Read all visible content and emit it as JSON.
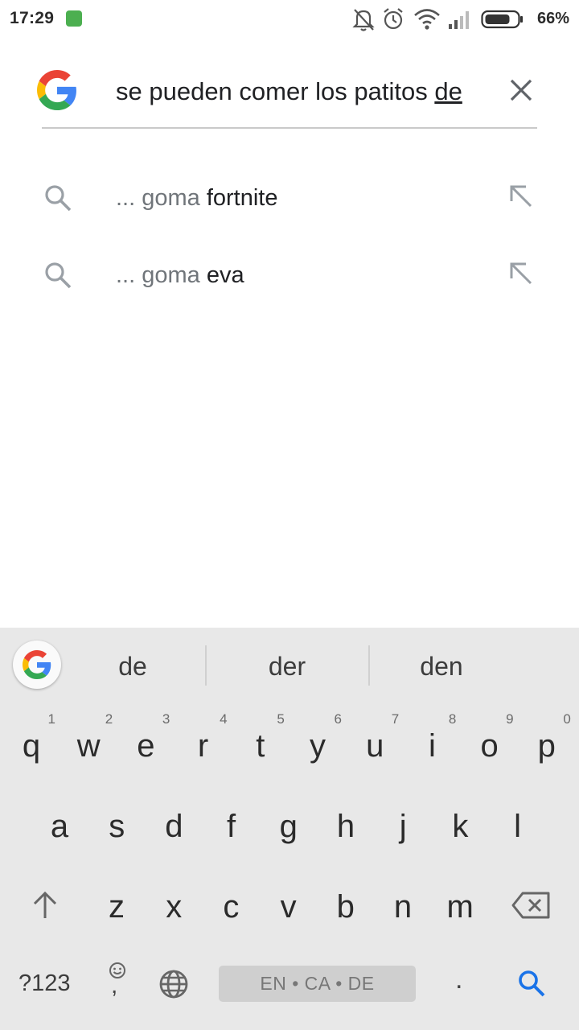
{
  "status_bar": {
    "time": "17:29",
    "battery_percent": "66%",
    "icons": [
      "android-app-icon",
      "bell-muted-icon",
      "alarm-icon",
      "wifi-icon",
      "signal-icon",
      "battery-icon"
    ]
  },
  "search": {
    "query_main": "se pueden comer los patitos ",
    "query_underlined": "de",
    "clear_icon": "close-icon"
  },
  "suggestions": [
    {
      "prefix": "... goma ",
      "completion": "fortnite"
    },
    {
      "prefix": "... goma ",
      "completion": "eva"
    }
  ],
  "keyboard": {
    "word_suggestions": [
      "de",
      "der",
      "den"
    ],
    "row1": [
      {
        "key": "q",
        "hint": "1"
      },
      {
        "key": "w",
        "hint": "2"
      },
      {
        "key": "e",
        "hint": "3"
      },
      {
        "key": "r",
        "hint": "4"
      },
      {
        "key": "t",
        "hint": "5"
      },
      {
        "key": "y",
        "hint": "6"
      },
      {
        "key": "u",
        "hint": "7"
      },
      {
        "key": "i",
        "hint": "8"
      },
      {
        "key": "o",
        "hint": "9"
      },
      {
        "key": "p",
        "hint": "0"
      }
    ],
    "row2": [
      "a",
      "s",
      "d",
      "f",
      "g",
      "h",
      "j",
      "k",
      "l"
    ],
    "row3": [
      "z",
      "x",
      "c",
      "v",
      "b",
      "n",
      "m"
    ],
    "symbols_label": "?123",
    "emoji_comma_label": ",",
    "space_label": "EN • CA • DE",
    "period_label": ".",
    "accent_color": "#1a73e8"
  },
  "colors": {
    "google_blue": "#4285F4",
    "google_red": "#EA4335",
    "google_yellow": "#FBBC05",
    "google_green": "#34A853"
  }
}
